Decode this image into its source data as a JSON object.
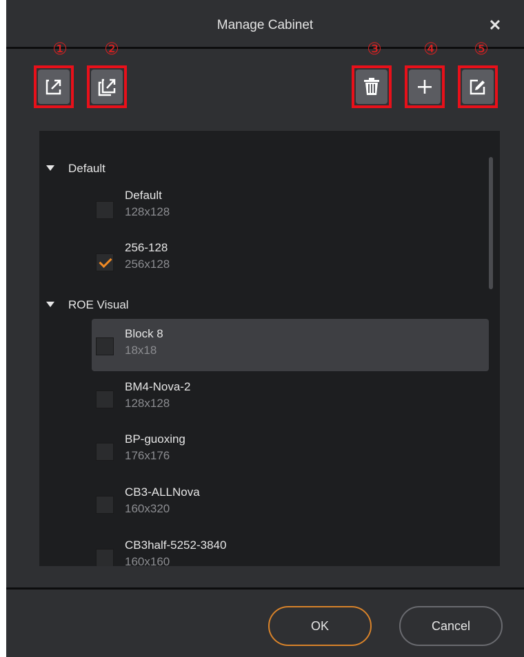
{
  "dialog": {
    "title": "Manage Cabinet",
    "close_label": "✕"
  },
  "toolbar": {
    "markers": [
      "①",
      "②",
      "③",
      "④",
      "⑤"
    ],
    "buttons": [
      {
        "icon": "export-icon"
      },
      {
        "icon": "export-all-icon"
      },
      {
        "icon": "trash-icon"
      },
      {
        "icon": "plus-icon"
      },
      {
        "icon": "edit-icon"
      }
    ],
    "highlight_color": "#e8101a"
  },
  "groups": [
    {
      "label": "Default",
      "items": [
        {
          "name": "Default",
          "size": "128x128",
          "checked": false
        },
        {
          "name": "256-128",
          "size": "256x128",
          "checked": true
        }
      ]
    },
    {
      "label": "ROE Visual",
      "items": [
        {
          "name": "Block 8",
          "size": "18x18",
          "checked": false
        },
        {
          "name": "BM4-Nova-2",
          "size": "128x128",
          "checked": false
        },
        {
          "name": "BP-guoxing",
          "size": "176x176",
          "checked": false
        },
        {
          "name": "CB3-ALLNova",
          "size": "160x320",
          "checked": false
        },
        {
          "name": "CB3half-5252-3840",
          "size": "160x160",
          "checked": false
        }
      ]
    }
  ],
  "footer": {
    "ok_label": "OK",
    "cancel_label": "Cancel"
  },
  "colors": {
    "accent": "#f08a24",
    "background": "#2f3033",
    "list_background": "#1d1e20"
  }
}
